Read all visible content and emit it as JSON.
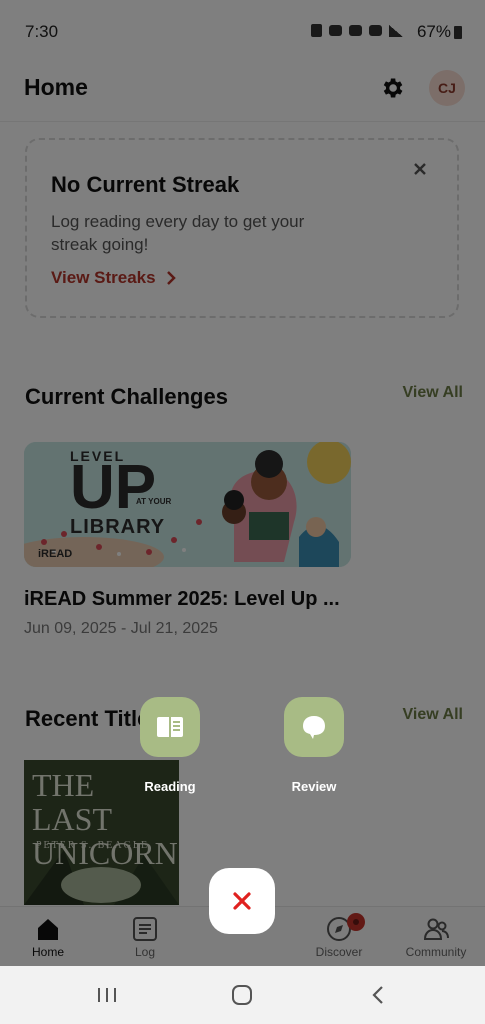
{
  "status_bar": {
    "time": "7:30",
    "battery": "67%"
  },
  "header": {
    "title": "Home",
    "avatar_initials": "CJ"
  },
  "streak_card": {
    "title": "No Current Streak",
    "message": "Log reading every day to get your streak going!",
    "link_label": "View Streaks"
  },
  "challenges": {
    "title": "Current Challenges",
    "view_all": "View All",
    "items": [
      {
        "name": "iREAD Summer 2025: Level Up ...",
        "dates": "Jun 09, 2025 - Jul 21, 2025",
        "banner_lines": [
          "LEVEL",
          "UP",
          "AT YOUR",
          "LIBRARY"
        ],
        "banner_brand": "iREAD"
      }
    ]
  },
  "recent_titles": {
    "title": "Recent Titles",
    "view_all": "View All",
    "books": [
      {
        "cover_title": "THE LAST UNICORN",
        "cover_author": "PETER S. BEAGLE"
      }
    ]
  },
  "fab_menu": {
    "reading_label": "Reading",
    "review_label": "Review",
    "close_icon": "close-icon"
  },
  "bottom_nav": {
    "items": [
      {
        "label": "Home",
        "icon": "home-icon"
      },
      {
        "label": "Log",
        "icon": "log-icon"
      },
      {
        "label": "Discover",
        "icon": "compass-icon"
      },
      {
        "label": "Community",
        "icon": "people-icon"
      }
    ]
  },
  "colors": {
    "accent_link": "#b5352a",
    "fab_green": "#a8bb85",
    "view_all": "#6d7d46",
    "close_red": "#e0211f"
  }
}
